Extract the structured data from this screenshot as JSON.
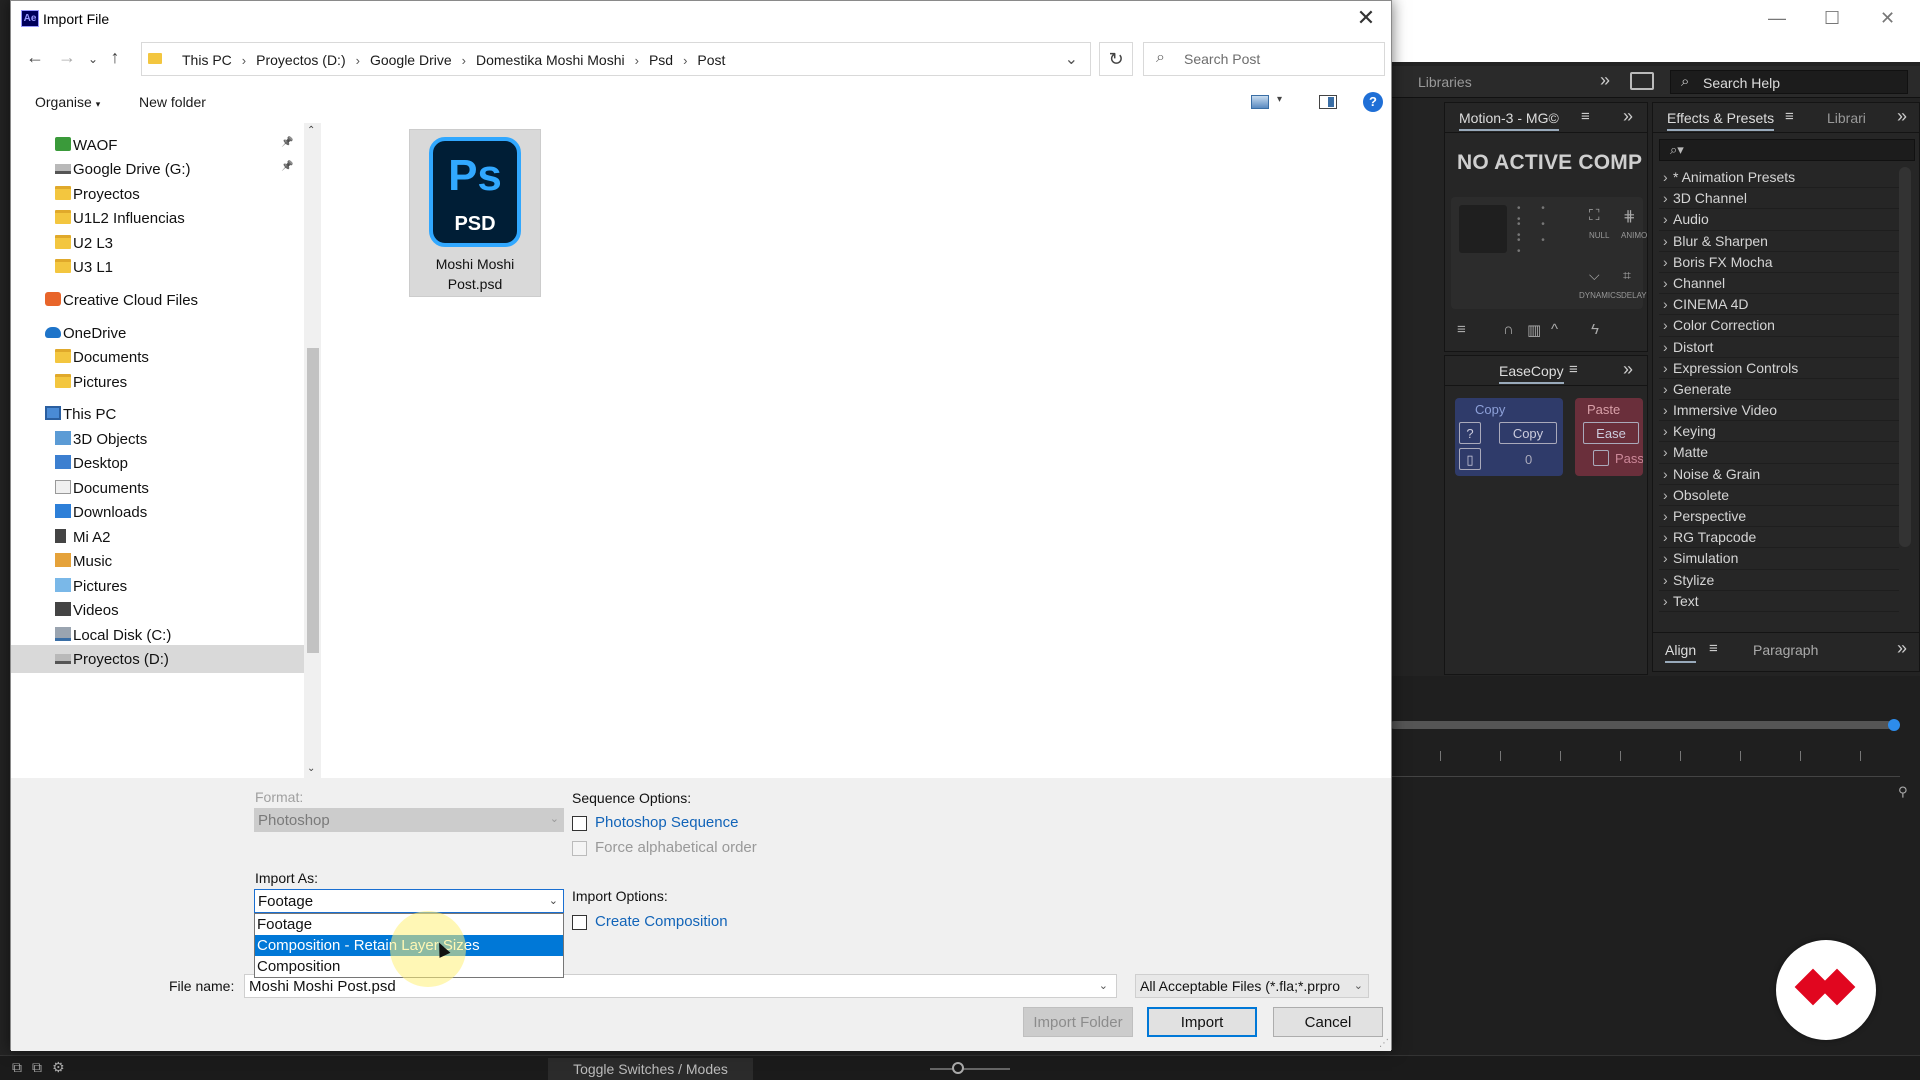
{
  "dialog": {
    "title": "Import File",
    "app_icon_text": "Ae",
    "close_glyph": "✕",
    "breadcrumbs": [
      "This PC",
      "Proyectos (D:)",
      "Google Drive",
      "Domestika Moshi Moshi",
      "Psd",
      "Post"
    ],
    "search_placeholder": "Search Post",
    "commands": {
      "organise": "Organise",
      "organise_caret": "▾",
      "new_folder": "New folder",
      "help": "?"
    },
    "nav_items": [
      {
        "label": "WAOF",
        "icon": "net",
        "indent": 1,
        "pinned": true
      },
      {
        "label": "Google Drive (G:)",
        "icon": "drive",
        "indent": 1,
        "pinned": true
      },
      {
        "label": "Proyectos",
        "icon": "folder",
        "indent": 1
      },
      {
        "label": "U1L2 Influencias",
        "icon": "folder",
        "indent": 1
      },
      {
        "label": "U2 L3",
        "icon": "folder",
        "indent": 1
      },
      {
        "label": "U3 L1",
        "icon": "folder",
        "indent": 1
      },
      {
        "label": "Creative Cloud Files",
        "icon": "cc",
        "indent": 0
      },
      {
        "label": "OneDrive",
        "icon": "cloud",
        "indent": 0
      },
      {
        "label": "Documents",
        "icon": "folder",
        "indent": 1
      },
      {
        "label": "Pictures",
        "icon": "folder",
        "indent": 1
      },
      {
        "label": "This PC",
        "icon": "pc",
        "indent": 0
      },
      {
        "label": "3D Objects",
        "icon": "obj",
        "indent": 1
      },
      {
        "label": "Desktop",
        "icon": "desk",
        "indent": 1
      },
      {
        "label": "Documents",
        "icon": "doc",
        "indent": 1
      },
      {
        "label": "Downloads",
        "icon": "dl",
        "indent": 1
      },
      {
        "label": "Mi A2",
        "icon": "phone",
        "indent": 1
      },
      {
        "label": "Music",
        "icon": "music",
        "indent": 1
      },
      {
        "label": "Pictures",
        "icon": "pic",
        "indent": 1
      },
      {
        "label": "Videos",
        "icon": "vid",
        "indent": 1
      },
      {
        "label": "Local Disk (C:)",
        "icon": "disk",
        "indent": 1
      },
      {
        "label": "Proyectos (D:)",
        "icon": "drive",
        "indent": 1,
        "selected": true
      }
    ],
    "file": {
      "name": "Moshi Moshi Post.psd",
      "icon_text": "Ps",
      "icon_badge": "PSD"
    },
    "format_label": "Format:",
    "format_value": "Photoshop",
    "sequence_options_label": "Sequence Options:",
    "photoshop_sequence": "Photoshop Sequence",
    "force_alpha": "Force alphabetical order",
    "import_as_label": "Import As:",
    "import_as_value": "Footage",
    "import_as_options": [
      "Footage",
      "Composition - Retain Layer Sizes",
      "Composition"
    ],
    "import_options_label": "Import Options:",
    "create_composition": "Create Composition",
    "file_name_label": "File name:",
    "file_name_value": "Moshi Moshi Post.psd",
    "filter_value": "All Acceptable Files (*.fla;*.prpro",
    "buttons": {
      "import_folder": "Import Folder",
      "import": "Import",
      "cancel": "Cancel"
    }
  },
  "ae": {
    "libraries_tab": "Libraries",
    "search_help_placeholder": "Search Help",
    "motion_tab": "Motion-3 - MG©",
    "no_active_comp": "NO ACTIVE COMP",
    "motion_labels": [
      "NULL",
      "ANIMO",
      "DYNAMICS",
      "DELAY"
    ],
    "easecopy_tab": "EaseCopy",
    "copy_label": "Copy",
    "copy_button": "Copy",
    "copy_count": "0",
    "paste_label": "Paste",
    "ease_button": "Ease",
    "pass_label": "Pass",
    "question": "?",
    "effects_tab": "Effects & Presets",
    "libraries_short": "Librari",
    "effects": [
      "* Animation Presets",
      "3D Channel",
      "Audio",
      "Blur & Sharpen",
      "Boris FX Mocha",
      "Channel",
      "CINEMA 4D",
      "Color Correction",
      "Distort",
      "Expression Controls",
      "Generate",
      "Immersive Video",
      "Keying",
      "Matte",
      "Noise & Grain",
      "Obsolete",
      "Perspective",
      "RG Trapcode",
      "Simulation",
      "Stylize",
      "Text"
    ],
    "align_tab": "Align",
    "paragraph_tab": "Paragraph",
    "toggle_switches": "Toggle Switches / Modes"
  },
  "colors": {
    "accent": "#0078d7",
    "highlight": "#0078d7",
    "ps_blue": "#31a8ff",
    "ps_dark": "#001e36",
    "brand_red": "#e1061f"
  }
}
